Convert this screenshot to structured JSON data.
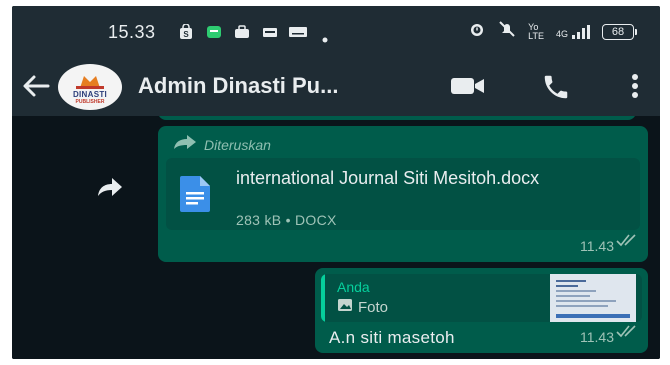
{
  "status_bar": {
    "time": "15.33",
    "network_small": "Yo\nLTE",
    "signal_label": "4G",
    "battery": "68"
  },
  "header": {
    "title": "Admin Dinasti Pu...",
    "avatar_text": "DINASTI",
    "avatar_subtext": "PUBLISHER"
  },
  "messages": [
    {
      "forwarded_label": "Diteruskan",
      "document_name": "international Journal Siti Mesitoh.docx",
      "document_meta": "283 kB • DOCX",
      "time": "11.43"
    },
    {
      "quote_author": "Anda",
      "quote_type": "Foto",
      "text": "A.n siti masetoh",
      "time": "11.43"
    }
  ],
  "colors": {
    "header_bg": "#1f2c34",
    "chat_bg": "#0b141a",
    "outgoing_bubble": "#005c4b",
    "accent": "#06cf9c"
  },
  "icons": {
    "back": "arrow-left-icon",
    "video": "video-camera-icon",
    "call": "phone-icon",
    "menu": "more-vertical-icon",
    "forward": "forward-arrow-icon",
    "document": "document-icon",
    "photo": "image-icon",
    "read": "double-check-icon"
  }
}
